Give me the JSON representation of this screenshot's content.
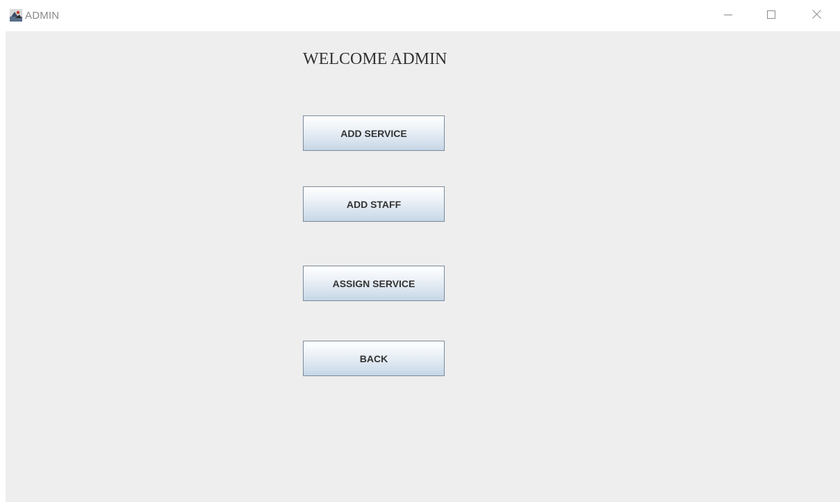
{
  "window": {
    "title": "ADMIN",
    "controls": {
      "minimize_icon": "minimize-icon",
      "maximize_icon": "maximize-icon",
      "close_icon": "close-icon"
    }
  },
  "main": {
    "heading": "WELCOME ADMIN",
    "buttons": [
      {
        "label": "ADD SERVICE"
      },
      {
        "label": "ADD STAFF"
      },
      {
        "label": "ASSIGN SERVICE"
      },
      {
        "label": "BACK"
      }
    ]
  },
  "colors": {
    "content_background": "#eeeeee",
    "titlebar_background": "#ffffff",
    "button_border": "#7a8a99",
    "text": "#333333"
  }
}
